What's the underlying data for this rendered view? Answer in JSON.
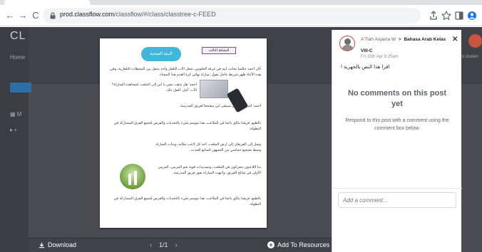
{
  "browser": {
    "url_host": "prod.classflow.com",
    "url_path": "/classflow/#/class/classtree-c-FEED",
    "nav": {
      "back": "←",
      "forward": "→",
      "reload": "C"
    }
  },
  "app": {
    "brand": "CL",
    "home": "Home",
    "side_row_1": "M",
    "right_snippet": "m studen"
  },
  "document": {
    "cloud_label": "البيئة الصحية",
    "header_label": "النشاط الثالث",
    "para1": "كان أحمد جالسا بجانب أبيه في غرفة الجلوس، شغل الأب التلفاز وأخذ يتنقل بين المحطات التلفازية، وفي هذه الأثناء ظهر شريط عاجل يقول: مباراة نهائي كرة القدم هذا المساء.",
    "para2": "أحمد: هل تذهب معي يا أبي إلى الملعب لمشاهدة المباراة؟ الأب: أجل، أفعل ذلك.",
    "para3": "أحمد: أشكرك يا أبي سيبقى أبي مشجعا لفريق المدرسة.",
    "para4": "بالطبع، فريقنا يتألق دائما في الملاعب، هذا موسم مليء بالتحديات والفرص لجميع الفرق المشاركة في البطولة.",
    "para5": "وصل إلى الفريقان إلى أرض الملعب. أخذ كل لاعب مكانه، وبدأت المباراة وسط تشجيع حماسي من الجمهور المتابع للحدث.",
    "para6": "بدأ اللاعبون يتحركون في الملعب، وتسديدات قوية نحو المرمى، المرمى الأولى في صالح الفريق، وانتهت المباراة بفوز فريق المدرسة."
  },
  "viewer": {
    "download_label": "Download",
    "prev": "‹",
    "page_indicator": "1/1",
    "next": "›",
    "add_label": "Add To Resources"
  },
  "comments": {
    "author": "A'Tiah Anjaina W",
    "class_name": "Bahasa Arab Kelas",
    "class_line2": "VIII-C",
    "time": "Fri 15th Apr 9:25am",
    "post_text": "اقرا هذا النص بالجهرية !",
    "empty_title": "No comments on this post yet",
    "respond_text": "Respond to this post with a comment using the comment box below.",
    "input_placeholder": "Add a comment..."
  }
}
